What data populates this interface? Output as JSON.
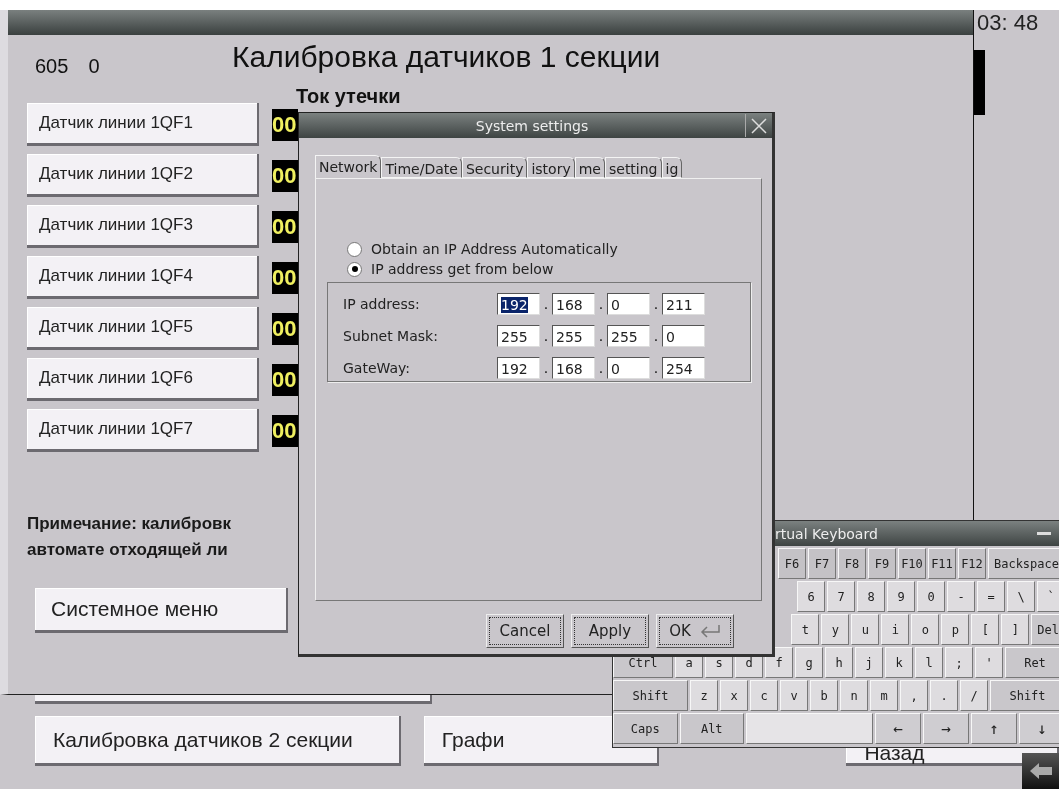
{
  "clock": "03: 48",
  "counter": [
    "605",
    "0"
  ],
  "title": "Калибровка датчиков 1 секции",
  "column_header": "Ток утечки",
  "sensors": [
    {
      "label": "Датчик линии 1QF1",
      "value": "00"
    },
    {
      "label": "Датчик линии 1QF2",
      "value": "00"
    },
    {
      "label": "Датчик линии 1QF3",
      "value": "00"
    },
    {
      "label": "Датчик линии 1QF4",
      "value": "00"
    },
    {
      "label": "Датчик линии 1QF5",
      "value": "00"
    },
    {
      "label": "Датчик линии 1QF6",
      "value": "00"
    },
    {
      "label": "Датчик линии 1QF7",
      "value": "00"
    }
  ],
  "note": [
    "Примечание: калибровк",
    "автомате отходящей ли"
  ],
  "system_menu_button": "Системное меню",
  "bottom_buttons": [
    "Калибровка датчиков 2 секции",
    "Графи",
    "Назад"
  ],
  "dialog": {
    "title": "System settings",
    "tabs": [
      {
        "label": "Network",
        "selected": true
      },
      {
        "label": "Time/Date",
        "selected": false
      },
      {
        "label": "Security",
        "selected": false
      },
      {
        "label": "istory",
        "selected": false
      },
      {
        "label": "me",
        "selected": false
      },
      {
        "label": "setting",
        "selected": false
      },
      {
        "label": "ig",
        "selected": false
      }
    ],
    "ip_mode": [
      {
        "label": "Obtain an IP Address Automatically",
        "selected": false
      },
      {
        "label": "IP address get from below",
        "selected": true
      }
    ],
    "ip_rows": [
      {
        "label": "IP address:",
        "octets": [
          {
            "value": "192",
            "selected": true
          },
          {
            "separator": ".",
            "value": "168",
            "selected": false
          },
          {
            "separator": ".",
            "value": "0",
            "selected": false
          },
          {
            "separator": ".",
            "value": "211",
            "selected": false
          }
        ]
      },
      {
        "label": "Subnet Mask:",
        "octets": [
          {
            "value": "255",
            "selected": false
          },
          {
            "separator": ".",
            "value": "255",
            "selected": false
          },
          {
            "separator": ".",
            "value": "255",
            "selected": false
          },
          {
            "separator": ".",
            "value": "0",
            "selected": false
          }
        ]
      },
      {
        "label": "GateWay:",
        "octets": [
          {
            "value": "192",
            "selected": false
          },
          {
            "separator": ".",
            "value": "168",
            "selected": false
          },
          {
            "separator": ".",
            "value": "0",
            "selected": false
          },
          {
            "separator": ".",
            "value": "254",
            "selected": false
          }
        ]
      }
    ],
    "buttons": [
      {
        "label": "Cancel",
        "kind": "plain"
      },
      {
        "label": "Apply",
        "kind": "plain"
      },
      {
        "label": "OK",
        "kind": "enter"
      }
    ]
  },
  "keyboard": {
    "title": "rtual Keyboard",
    "rows": [
      {
        "keys": [
          {
            "label": "F6",
            "kind": "fn"
          },
          {
            "label": "F7",
            "kind": "fn"
          },
          {
            "label": "F8",
            "kind": "fn"
          },
          {
            "label": "F9",
            "kind": "fn"
          },
          {
            "label": "F10",
            "kind": "fn"
          },
          {
            "label": "F11",
            "kind": "fn"
          },
          {
            "label": "F12",
            "kind": "fn"
          },
          {
            "label": "Backspace",
            "kind": "long"
          }
        ]
      },
      {
        "keys": [
          {
            "label": "6",
            "kind": "key"
          },
          {
            "label": "7",
            "kind": "key"
          },
          {
            "label": "8",
            "kind": "key"
          },
          {
            "label": "9",
            "kind": "key"
          },
          {
            "label": "0",
            "kind": "key"
          },
          {
            "label": "-",
            "kind": "key"
          },
          {
            "label": "=",
            "kind": "key"
          },
          {
            "label": "\\",
            "kind": "key"
          },
          {
            "label": "`",
            "kind": "key"
          }
        ]
      },
      {
        "keys": [
          {
            "label": "t",
            "kind": "key"
          },
          {
            "label": "y",
            "kind": "key"
          },
          {
            "label": "u",
            "kind": "key"
          },
          {
            "label": "i",
            "kind": "key"
          },
          {
            "label": "o",
            "kind": "key"
          },
          {
            "label": "p",
            "kind": "key"
          },
          {
            "label": "[",
            "kind": "key"
          },
          {
            "label": "]",
            "kind": "key"
          },
          {
            "label": "Del",
            "kind": "long"
          }
        ]
      },
      {
        "keys": [
          {
            "label": "Ctrl",
            "kind": "mod"
          },
          {
            "label": "a",
            "kind": "key"
          },
          {
            "label": "s",
            "kind": "key"
          },
          {
            "label": "d",
            "kind": "key"
          },
          {
            "label": "f",
            "kind": "key"
          },
          {
            "label": "g",
            "kind": "key"
          },
          {
            "label": "h",
            "kind": "key"
          },
          {
            "label": "j",
            "kind": "key"
          },
          {
            "label": "k",
            "kind": "key"
          },
          {
            "label": "l",
            "kind": "key"
          },
          {
            "label": ";",
            "kind": "key"
          },
          {
            "label": "'",
            "kind": "key"
          },
          {
            "label": "Ret",
            "kind": "mod"
          }
        ]
      },
      {
        "keys": [
          {
            "label": "Shift",
            "kind": "mod"
          },
          {
            "label": "z",
            "kind": "key"
          },
          {
            "label": "x",
            "kind": "key"
          },
          {
            "label": "c",
            "kind": "key"
          },
          {
            "label": "v",
            "kind": "key"
          },
          {
            "label": "b",
            "kind": "key"
          },
          {
            "label": "n",
            "kind": "key"
          },
          {
            "label": "m",
            "kind": "key"
          },
          {
            "label": ",",
            "kind": "key"
          },
          {
            "label": ".",
            "kind": "key"
          },
          {
            "label": "/",
            "kind": "key"
          },
          {
            "label": "Shift",
            "kind": "mod"
          }
        ]
      },
      {
        "keys": [
          {
            "label": "Caps",
            "kind": "mod"
          },
          {
            "label": "Alt",
            "kind": "mod"
          },
          {
            "kind": "space"
          },
          {
            "label": "←",
            "kind": "arrow"
          },
          {
            "label": "→",
            "kind": "arrow"
          },
          {
            "label": "↑",
            "kind": "arrow"
          },
          {
            "label": "↓",
            "kind": "arrow"
          }
        ]
      }
    ]
  }
}
